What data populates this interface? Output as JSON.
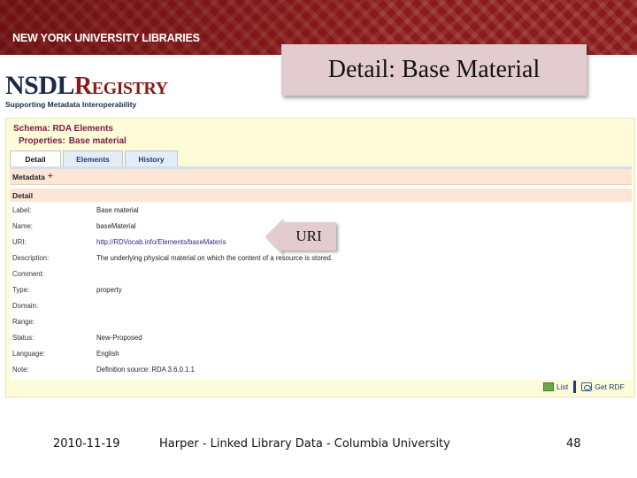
{
  "header": {
    "nyu_title": "NEW YORK UNIVERSITY LIBRARIES"
  },
  "logo": {
    "main": "NSDL",
    "registry": "Registry",
    "tagline": "Supporting Metadata Interoperability"
  },
  "slide": {
    "title": "Detail: Base Material",
    "uri_callout": "URI"
  },
  "registry": {
    "schema_line": "Schema: RDA Elements",
    "properties_label": "Properties:",
    "properties_value": "Base material",
    "tabs": [
      {
        "label": "Detail",
        "active": true
      },
      {
        "label": "Elements",
        "active": false
      },
      {
        "label": "History",
        "active": false
      }
    ],
    "metadata_label": "Metadata",
    "plus_icon": "+",
    "detail_label": "Detail",
    "rows": [
      {
        "label": "Label:",
        "value": "Base material"
      },
      {
        "label": "Name:",
        "value": "baseMaterial"
      },
      {
        "label": "URI:",
        "value": "http://RDVocab.info/Elements/baseMateris"
      },
      {
        "label": "Description:",
        "value": "The underlying physical material on which the content of a resource is stored."
      },
      {
        "label": "Comment:",
        "value": ""
      },
      {
        "label": "Type:",
        "value": "property"
      },
      {
        "label": "Domain:",
        "value": ""
      },
      {
        "label": "Range:",
        "value": ""
      },
      {
        "label": "Status:",
        "value": "New-Proposed"
      },
      {
        "label": "Language:",
        "value": "English"
      },
      {
        "label": "Note:",
        "value": "Definition source: RDA 3.6.0.1.1"
      }
    ],
    "bottom_links": {
      "list": "List",
      "rdf": "Get RDF"
    }
  },
  "footer": {
    "date": "2010-11-19",
    "center": "Harper - Linked Library Data - Columbia University",
    "page": "48"
  },
  "colors": {
    "nyu_band": "#8b1a1a",
    "panel_bg": "#fdfbd8",
    "callout_bg": "#e3ccd0",
    "section_bar": "#fbe6d8",
    "brand_text": "#7a1a4a"
  }
}
